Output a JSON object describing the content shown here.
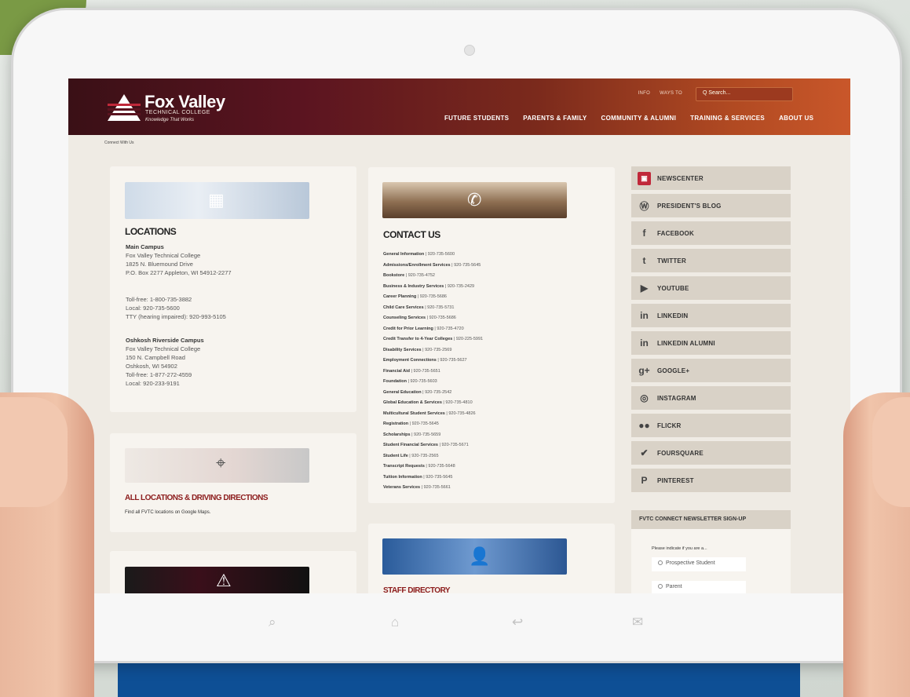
{
  "site": {
    "logo_title": "Fox Valley",
    "logo_subtitle": "TECHNICAL COLLEGE",
    "logo_tagline": "Knowledge That Works",
    "top_links": [
      "INFO",
      "WAYS TO"
    ],
    "search_placeholder": "Q Search...",
    "nav": [
      "FUTURE STUDENTS",
      "PARENTS & FAMILY",
      "COMMUNITY & ALUMNI",
      "TRAINING & SERVICES",
      "ABOUT US"
    ],
    "breadcrumb": "Connect With Us"
  },
  "locations": {
    "title": "LOCATIONS",
    "main_campus_name": "Main Campus",
    "main_campus_lines": [
      "Fox Valley Technical College",
      "1825 N. Bluemound Drive",
      "P.O. Box 2277 Appleton, WI 54912-2277"
    ],
    "phones": [
      "Toll-free: 1-800-735-3882",
      "Local: 920-735-5600",
      "TTY (hearing impaired): 920-993-5105"
    ],
    "oshkosh_name": "Oshkosh Riverside Campus",
    "oshkosh_lines": [
      "Fox Valley Technical College",
      "150 N. Campbell Road",
      "Oshkosh, WI 54902",
      "Toll-free: 1-877-272-4559",
      "Local: 920-233-9191"
    ]
  },
  "driving": {
    "title": "ALL LOCATIONS & DRIVING DIRECTIONS",
    "text": "Find all FVTC locations on Google Maps."
  },
  "contact": {
    "title": "CONTACT US",
    "items": [
      {
        "name": "General Information",
        "phone": "920-735-5600"
      },
      {
        "name": "Admissions/Enrollment Services",
        "phone": "920-735-5645"
      },
      {
        "name": "Bookstore",
        "phone": "920-735-4752"
      },
      {
        "name": "Business & Industry Services",
        "phone": "920-735-2429"
      },
      {
        "name": "Career Planning",
        "phone": "920-735-5686"
      },
      {
        "name": "Child Care Services",
        "phone": "920-735-5731"
      },
      {
        "name": "Counseling Services",
        "phone": "920-735-5686"
      },
      {
        "name": "Credit for Prior Learning",
        "phone": "920-735-4720"
      },
      {
        "name": "Credit Transfer to 4-Year Colleges",
        "phone": "920-225-5991"
      },
      {
        "name": "Disability Services",
        "phone": "920-735-2569"
      },
      {
        "name": "Employment Connections",
        "phone": "920-735-5627"
      },
      {
        "name": "Financial Aid",
        "phone": "920-735-5651"
      },
      {
        "name": "Foundation",
        "phone": "920-735-5603"
      },
      {
        "name": "General Education",
        "phone": "920-735-2542"
      },
      {
        "name": "Global Education & Services",
        "phone": "920-735-4810"
      },
      {
        "name": "Multicultural Student Services",
        "phone": "920-735-4826"
      },
      {
        "name": "Registration",
        "phone": "920-735-5645"
      },
      {
        "name": "Scholarships",
        "phone": "920-735-5659"
      },
      {
        "name": "Student Financial Services",
        "phone": "920-735-5671"
      },
      {
        "name": "Student Life",
        "phone": "920-735-2565"
      },
      {
        "name": "Transcript Requests",
        "phone": "920-735-5648"
      },
      {
        "name": "Tuition Information",
        "phone": "920-735-5645"
      },
      {
        "name": "Veterans Services",
        "phone": "920-735-5661"
      }
    ]
  },
  "staff": {
    "title": "STAFF DIRECTORY"
  },
  "social": [
    {
      "icon": "newscenter-icon",
      "glyph": "▣",
      "label": "NEWSCENTER",
      "accent": true
    },
    {
      "icon": "wordpress-icon",
      "glyph": "Ⓦ",
      "label": "PRESIDENT'S BLOG",
      "accent": false
    },
    {
      "icon": "facebook-icon",
      "glyph": "f",
      "label": "FACEBOOK",
      "accent": false
    },
    {
      "icon": "twitter-icon",
      "glyph": "t",
      "label": "TWITTER",
      "accent": false
    },
    {
      "icon": "youtube-icon",
      "glyph": "▶",
      "label": "YOUTUBE",
      "accent": false
    },
    {
      "icon": "linkedin-icon",
      "glyph": "in",
      "label": "LINKEDIN",
      "accent": false
    },
    {
      "icon": "linkedin-alumni-icon",
      "glyph": "in",
      "label": "LINKEDIN ALUMNI",
      "accent": false
    },
    {
      "icon": "google-plus-icon",
      "glyph": "g+",
      "label": "GOOGLE+",
      "accent": false
    },
    {
      "icon": "instagram-icon",
      "glyph": "◎",
      "label": "INSTAGRAM",
      "accent": false
    },
    {
      "icon": "flickr-icon",
      "glyph": "●●",
      "label": "FLICKR",
      "accent": false
    },
    {
      "icon": "foursquare-icon",
      "glyph": "✔",
      "label": "FOURSQUARE",
      "accent": false
    },
    {
      "icon": "pinterest-icon",
      "glyph": "P",
      "label": "PINTEREST",
      "accent": false
    }
  ],
  "newsletter": {
    "title": "FVTC CONNECT NEWSLETTER SIGN-UP",
    "question": "Please indicate if you are a...",
    "options": [
      "Prospective Student",
      "Parent"
    ]
  },
  "colors": {
    "header_start": "#3a1016",
    "header_end": "#c9572a",
    "accent_red": "#8c1c1c",
    "banner_blue": "#0e4f95"
  }
}
